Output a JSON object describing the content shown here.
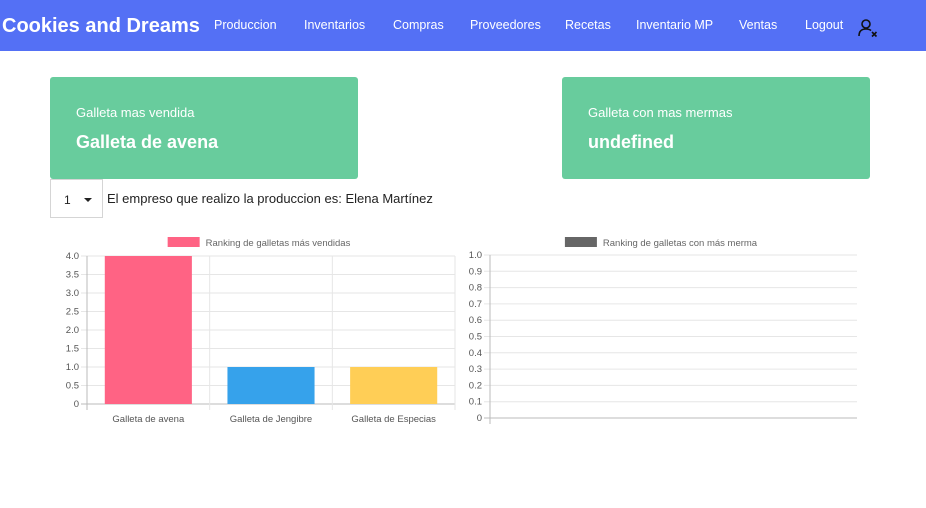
{
  "app": {
    "title": "Cookies and Dreams"
  },
  "nav": {
    "items": [
      {
        "label": "Produccion"
      },
      {
        "label": "Inventarios"
      },
      {
        "label": "Compras"
      },
      {
        "label": "Proveedores"
      },
      {
        "label": "Recetas"
      },
      {
        "label": "Inventario MP"
      },
      {
        "label": "Ventas"
      },
      {
        "label": "Logout"
      }
    ],
    "user_icon": "user-remove-icon"
  },
  "cards": {
    "best_seller": {
      "label": "Galleta mas vendida",
      "value": "Galleta de avena"
    },
    "most_waste": {
      "label": "Galleta con mas mermas",
      "value": "undefined"
    }
  },
  "employee": {
    "select_value": "1",
    "text": "El empreso que realizo la produccion es: Elena Martínez"
  },
  "colors": {
    "navbar": "#5470f5",
    "card": "#68cc9d"
  },
  "chart_data": [
    {
      "type": "bar",
      "legend": "Ranking de galletas más vendidas",
      "categories": [
        "Galleta de avena",
        "Galleta de Jengibre",
        "Galleta de Especias"
      ],
      "series": [
        {
          "name": "Ranking de galletas más vendidas",
          "values": [
            4,
            1,
            1
          ]
        }
      ],
      "colors": [
        "#ff6384",
        "#36a2eb",
        "#ffce56"
      ],
      "legend_color": "#ff6384",
      "ylim": [
        0,
        4
      ],
      "yticks": [
        "0",
        "0.5",
        "1.0",
        "1.5",
        "2.0",
        "2.5",
        "3.0",
        "3.5",
        "4.0"
      ],
      "grid": true,
      "legend_position": "top"
    },
    {
      "type": "bar",
      "legend": "Ranking de galletas con más merma",
      "categories": [],
      "series": [
        {
          "name": "Ranking de galletas con más merma",
          "values": []
        }
      ],
      "legend_color": "#666666",
      "ylim": [
        0,
        1
      ],
      "yticks": [
        "0",
        "0.1",
        "0.2",
        "0.3",
        "0.4",
        "0.5",
        "0.6",
        "0.7",
        "0.8",
        "0.9",
        "1.0"
      ],
      "grid": true,
      "legend_position": "top"
    }
  ]
}
